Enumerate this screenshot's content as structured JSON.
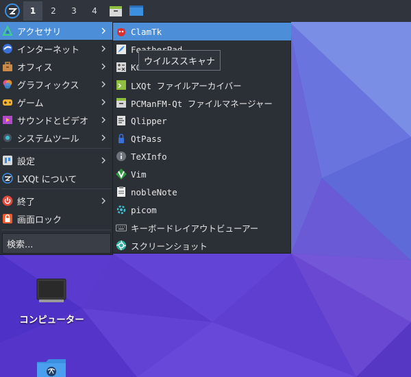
{
  "panel": {
    "workspaces": [
      "1",
      "2",
      "3",
      "4"
    ],
    "active_workspace": "1",
    "quicklaunch_icons": [
      "file-manager-icon",
      "desktop-icon"
    ]
  },
  "menu": {
    "items": [
      {
        "label": "アクセサリ",
        "icon": "accessories-icon",
        "submenu": true,
        "highlighted": true
      },
      {
        "label": "インターネット",
        "icon": "internet-icon",
        "submenu": true
      },
      {
        "label": "オフィス",
        "icon": "office-icon",
        "submenu": true
      },
      {
        "label": "グラフィックス",
        "icon": "graphics-icon",
        "submenu": true
      },
      {
        "label": "ゲーム",
        "icon": "games-icon",
        "submenu": true
      },
      {
        "label": "サウンドとビデオ",
        "icon": "multimedia-icon",
        "submenu": true
      },
      {
        "label": "システムツール",
        "icon": "system-tools-icon",
        "submenu": true
      },
      {
        "label": "設定",
        "icon": "settings-icon",
        "submenu": true
      },
      {
        "label": "LXQt について",
        "icon": "lxqt-icon",
        "submenu": false
      },
      {
        "label": "終了",
        "icon": "power-icon",
        "submenu": true
      },
      {
        "label": "画面ロック",
        "icon": "lock-icon",
        "submenu": false
      }
    ],
    "search_placeholder": "検索..."
  },
  "submenu": {
    "items": [
      {
        "label": "ClamTk",
        "icon": "clamtk-icon",
        "highlighted": true
      },
      {
        "label": "FeatherPad",
        "icon": "featherpad-icon"
      },
      {
        "label": "KCalc",
        "icon": "calculator-icon"
      },
      {
        "label": "LXQt ファイルアーカイバー",
        "icon": "archiver-icon"
      },
      {
        "label": "PCManFM-Qt ファイルマネージャー",
        "icon": "file-manager-icon"
      },
      {
        "label": "Qlipper",
        "icon": "clipboard-icon"
      },
      {
        "label": "QtPass",
        "icon": "qtpass-icon"
      },
      {
        "label": "TeXInfo",
        "icon": "info-icon"
      },
      {
        "label": "Vim",
        "icon": "vim-icon"
      },
      {
        "label": "nobleNote",
        "icon": "noblenote-icon"
      },
      {
        "label": "picom",
        "icon": "picom-icon"
      },
      {
        "label": "キーボードレイアウトビューアー",
        "icon": "keyboard-icon"
      },
      {
        "label": "スクリーンショット",
        "icon": "screenshot-icon"
      }
    ]
  },
  "tooltip": {
    "text": "ウイルススキャナ"
  },
  "desktop": {
    "icons": [
      {
        "label": "コンピューター",
        "icon": "computer-icon"
      },
      {
        "label": "",
        "icon": "network-folder-icon"
      }
    ]
  },
  "colors": {
    "highlight": "#4c8fd8",
    "panel": "#2f343d",
    "menu_bg": "#2b2f36"
  }
}
